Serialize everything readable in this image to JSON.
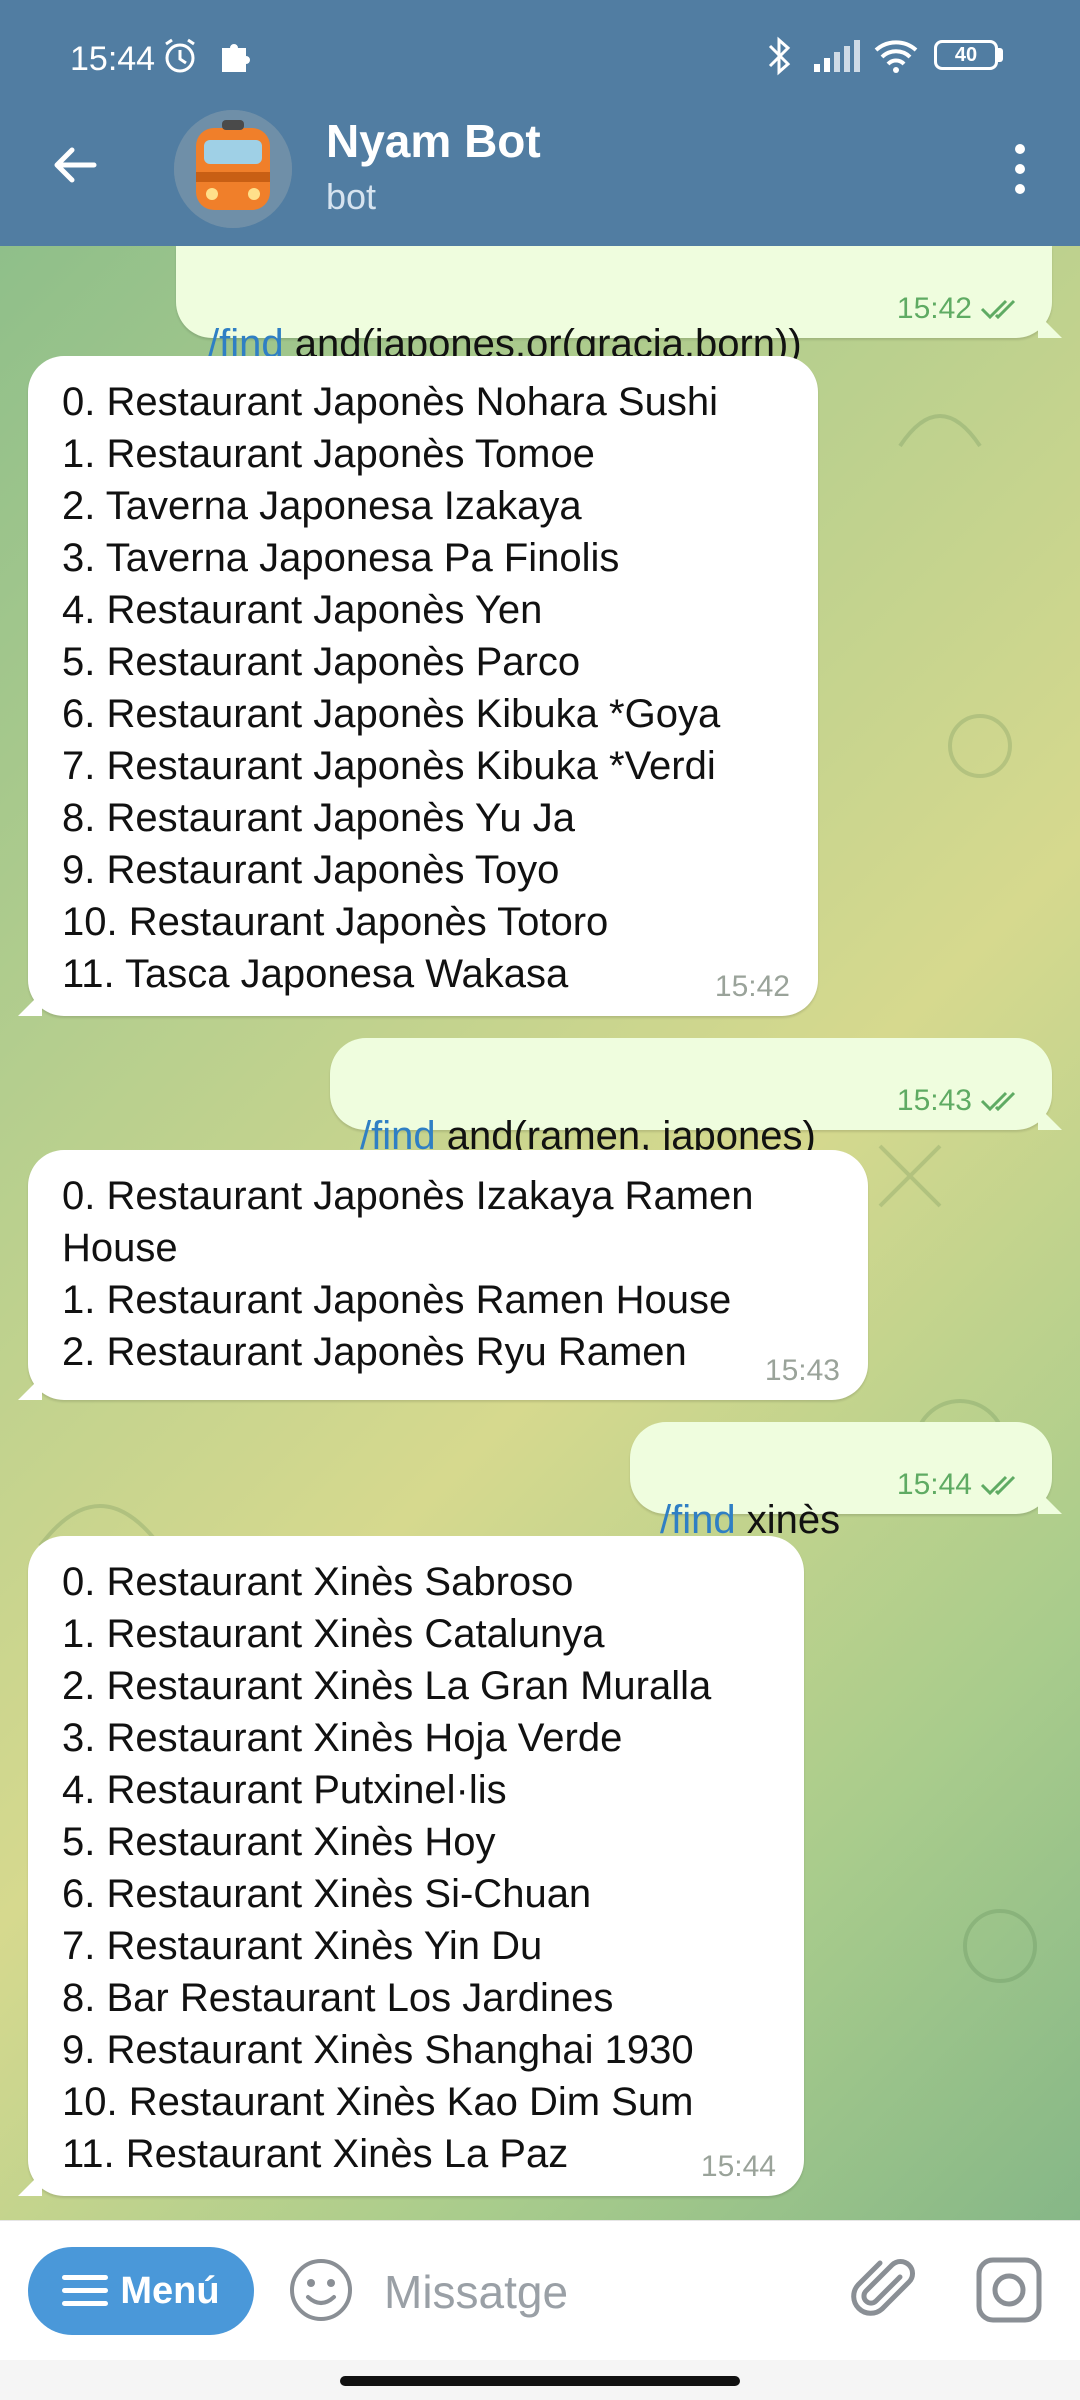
{
  "status_bar": {
    "time": "15:44",
    "battery": "40"
  },
  "header": {
    "title": "Nyam Bot",
    "subtitle": "bot"
  },
  "messages": [
    {
      "dir": "out",
      "command": "/find",
      "text": " and(japones,or(gracia,born))",
      "time": "15:42",
      "read": true
    },
    {
      "dir": "in",
      "text": "0. Restaurant Japonès Nohara Sushi\n1. Restaurant Japonès Tomoe\n2. Taverna Japonesa Izakaya\n3. Taverna Japonesa Pa Finolis\n4. Restaurant Japonès Yen\n5. Restaurant Japonès Parco\n6. Restaurant Japonès Kibuka *Goya\n7. Restaurant Japonès Kibuka *Verdi\n8. Restaurant Japonès Yu Ja\n9. Restaurant Japonès Toyo\n10. Restaurant Japonès Totoro\n11. Tasca Japonesa Wakasa",
      "time": "15:42"
    },
    {
      "dir": "out",
      "command": "/find",
      "text": " and(ramen, japones)",
      "time": "15:43",
      "read": true
    },
    {
      "dir": "in",
      "text": "0. Restaurant Japonès Izakaya Ramen\nHouse\n1. Restaurant Japonès Ramen House\n2. Restaurant Japonès Ryu Ramen",
      "time": "15:43"
    },
    {
      "dir": "out",
      "command": "/find",
      "text": " xinès",
      "time": "15:44",
      "read": true
    },
    {
      "dir": "in",
      "text": "0. Restaurant Xinès Sabroso\n1. Restaurant Xinès Catalunya\n2. Restaurant Xinès La Gran Muralla\n3. Restaurant Xinès Hoja Verde\n4. Restaurant Putxinel·lis\n5. Restaurant Xinès Hoy\n6. Restaurant Xinès Si-Chuan\n7. Restaurant Xinès Yin Du\n8. Bar Restaurant Los Jardines\n9. Restaurant Xinès Shanghai 1930\n10. Restaurant Xinès Kao Dim Sum\n11. Restaurant Xinès La Paz",
      "time": "15:44"
    }
  ],
  "input": {
    "menu_label": "Menú",
    "placeholder": "Missatge"
  },
  "colors": {
    "header": "#517da2",
    "outgoing": "#effdde",
    "command": "#2f7fc4",
    "menu_button": "#4a98d9"
  }
}
